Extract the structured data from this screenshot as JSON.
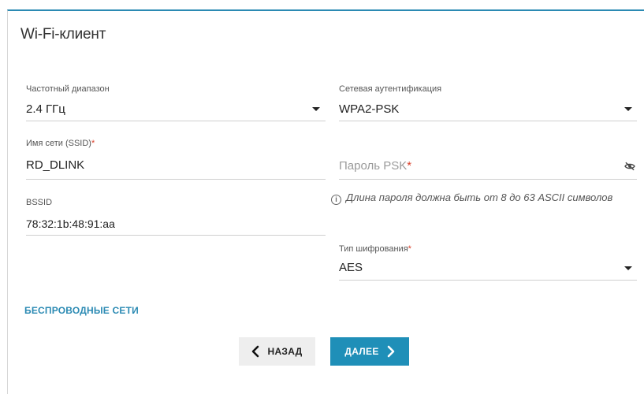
{
  "page": {
    "title": "Wi-Fi-клиент"
  },
  "form": {
    "band": {
      "label": "Частотный диапазон",
      "value": "2.4 ГГц"
    },
    "auth": {
      "label": "Сетевая аутентификация",
      "value": "WPA2-PSK"
    },
    "ssid": {
      "label": "Имя сети (SSID)",
      "required_mark": "*",
      "value": "RD_DLINK"
    },
    "psk": {
      "placeholder": "Пароль PSK",
      "required_mark": "*"
    },
    "bssid": {
      "label": "BSSID",
      "value": "78:32:1b:48:91:aa"
    },
    "hint": {
      "info_icon": "i",
      "text": "Длина пароля должна быть от 8 до 63 ASCII символов"
    },
    "encryption": {
      "label": "Тип шифрования",
      "required_mark": "*",
      "value": "AES"
    }
  },
  "links": {
    "wireless_networks": "БЕСПРОВОДНЫЕ СЕТИ"
  },
  "buttons": {
    "back": "НАЗАД",
    "next": "ДАЛЕЕ"
  },
  "colors": {
    "accent": "#1f8fb8",
    "required": "#d9402b",
    "link": "#2b8ab3"
  },
  "icons": {
    "dropdown": "chevron-down-icon",
    "password_toggle": "eye-off-icon",
    "info": "info-icon",
    "back": "chevron-left-icon",
    "next": "chevron-right-icon"
  }
}
